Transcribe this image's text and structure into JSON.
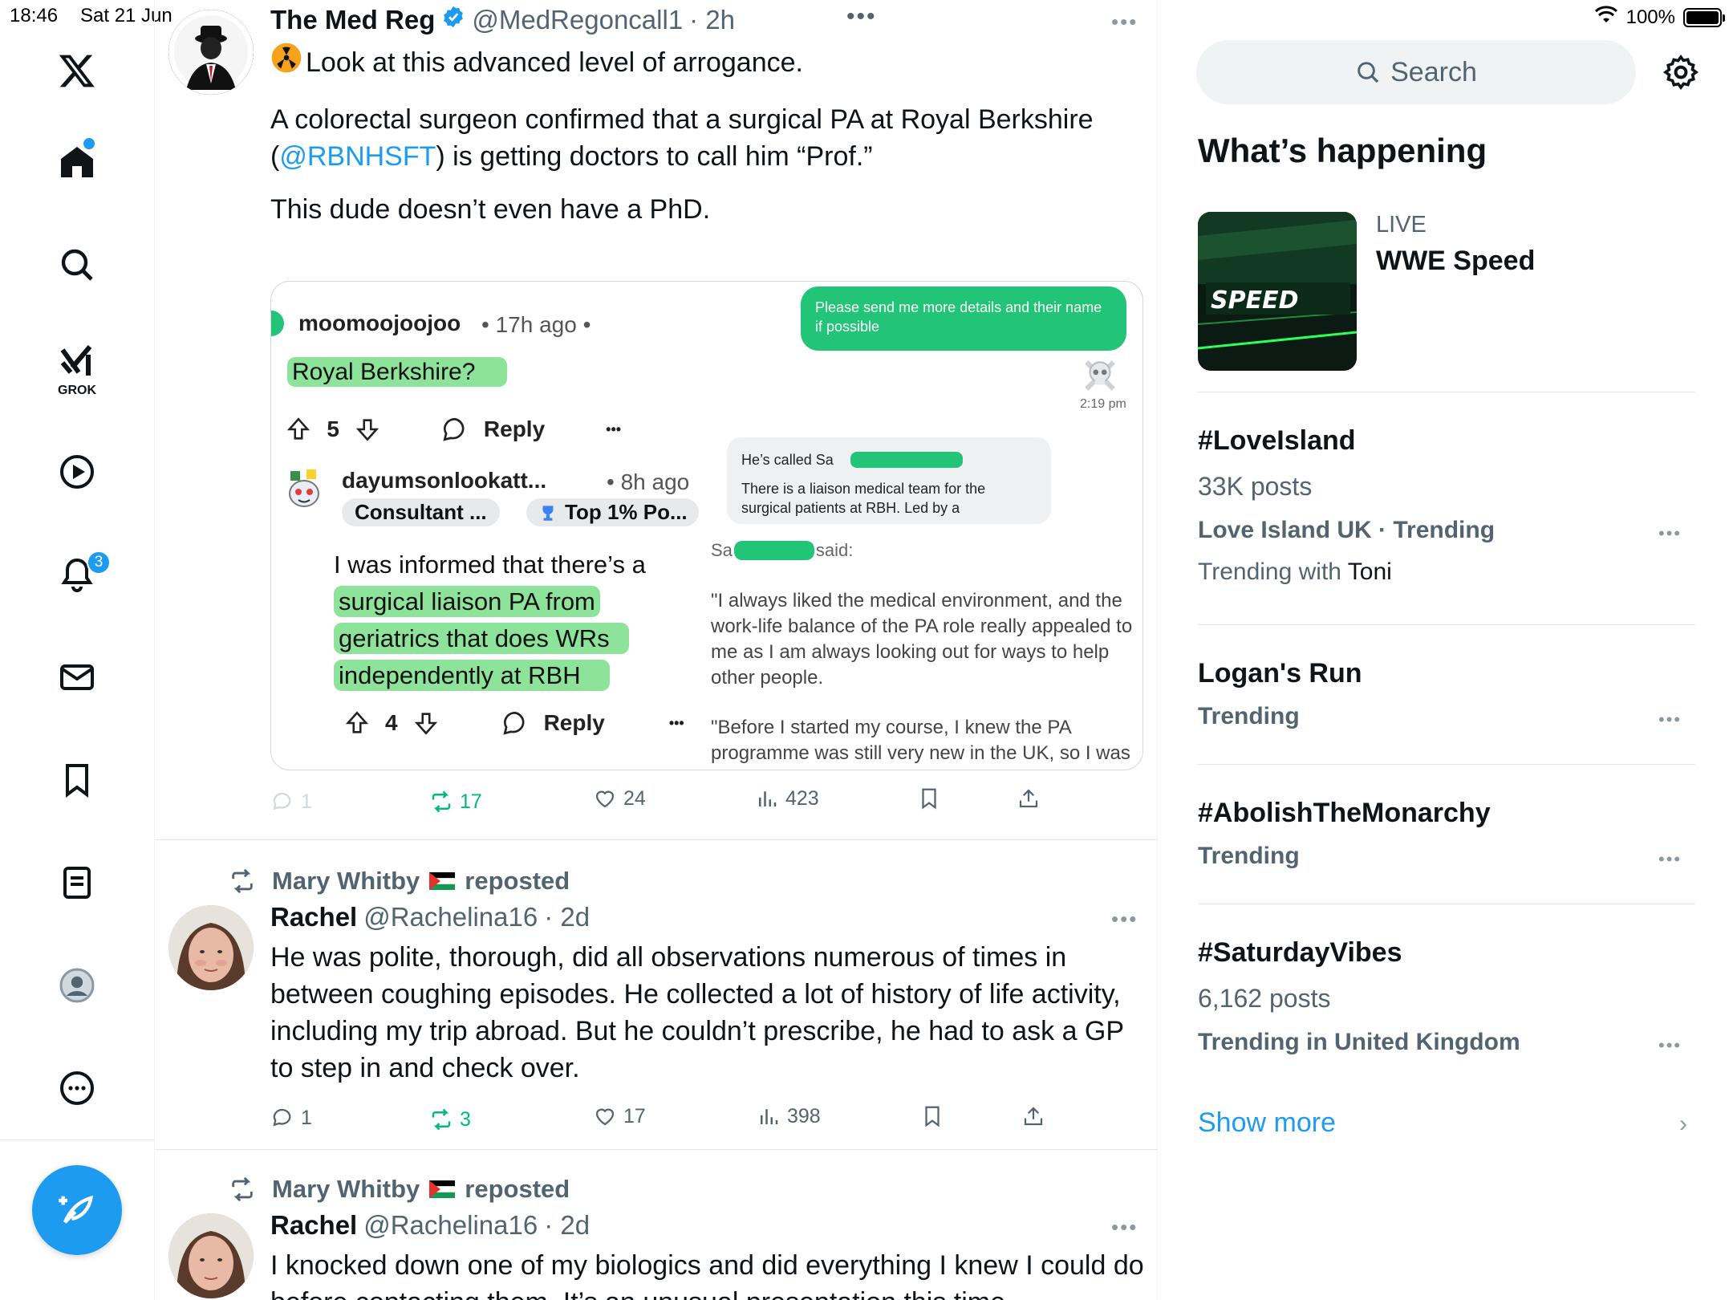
{
  "status_bar": {
    "time": "18:46",
    "date": "Sat 21 Jun",
    "battery": "100%"
  },
  "nav": {
    "grok_label": "GROK",
    "notifications_badge": "3"
  },
  "tweet1": {
    "name": "The Med Reg",
    "handle": "@MedRegoncall1",
    "time": "· 2h",
    "line1": "Look at this advanced level of arrogance.",
    "line2a": "A colorectal surgeon confirmed that a surgical PA at Royal Berkshire",
    "line2b_open": "(",
    "line2b_link": "@RBNHSFT",
    "line2b_rest": ") is getting doctors to call him “Prof.”",
    "line3": "This dude doesn’t even have a PhD.",
    "actions": {
      "replies": "1",
      "reposts": "17",
      "likes": "24",
      "views": "423"
    }
  },
  "media": {
    "user1": "moomoojoojoo",
    "user1_meta": "• 17h ago •",
    "comment1": "Royal Berkshire?",
    "votes1": "5",
    "reply_label": "Reply",
    "dots": "•••",
    "user2": "dayumsonlookatt...",
    "user2_meta": "• 8h ago",
    "flair1": "Consultant ...",
    "flair2": "Top 1% Po...",
    "comment2_l1": "I was informed that there’s a",
    "comment2_l2": "surgical liaison PA from",
    "comment2_l3": "geriatrics that does WRs",
    "comment2_l4": "independently at RBH",
    "votes2": "4",
    "green_bubble": "Please send me more details and their name if possible",
    "time_stamp": "2:19 pm",
    "grey_l1": "He’s called Sa",
    "grey_l2": "There is a liaison medical team for the",
    "grey_l3": "surgical patients at RBH. Led by a",
    "said_prefix": "Sa",
    "said_suffix": "said:",
    "quote1": "\"I always liked the medical environment, and the work-life balance of the PA role really appealed to me as I am always looking out for ways to help other people.",
    "quote2": "\"Before I started my course, I knew the PA programme was still very new in the UK, so I was"
  },
  "tweet2": {
    "repost_by": "Mary Whitby",
    "repost_label": "reposted",
    "name": "Rachel",
    "handle": "@Rachelina16",
    "time": "· 2d",
    "text": "He was polite, thorough, did all observations numerous of times in between coughing episodes. He collected a lot of history of life activity, including my trip abroad. But he couldn’t prescribe, he had to ask a GP to step in and check over.",
    "actions": {
      "replies": "1",
      "reposts": "3",
      "likes": "17",
      "views": "398"
    }
  },
  "tweet3": {
    "repost_by": "Mary Whitby",
    "repost_label": "reposted",
    "name": "Rachel",
    "handle": "@Rachelina16",
    "time": "· 2d",
    "text": "I knocked down one of my biologics and did everything I knew I could do before contacting them. It’s an unusual presentation this time"
  },
  "sidebar": {
    "search_placeholder": "Search",
    "section_title": "What’s happening",
    "live_label": "LIVE",
    "live_title": "WWE Speed",
    "thumb_text": "SPEED",
    "trends": [
      {
        "title": "#LoveIsland",
        "sub": "33K posts",
        "ctx": "Love Island UK · Trending",
        "ctx2_prefix": "Trending with ",
        "ctx2_name": "Toni"
      },
      {
        "title": "Logan's Run",
        "ctx": "Trending"
      },
      {
        "title": "#AbolishTheMonarchy",
        "ctx": "Trending"
      },
      {
        "title": "#SaturdayVibes",
        "sub": "6,162 posts",
        "ctx": "Trending in United Kingdom"
      }
    ],
    "show_more": "Show more"
  },
  "colors": {
    "accent": "#1d9bf0",
    "repost_green": "#00ba7c",
    "highlight": "#8ee39a",
    "chat_green": "#22c477"
  }
}
